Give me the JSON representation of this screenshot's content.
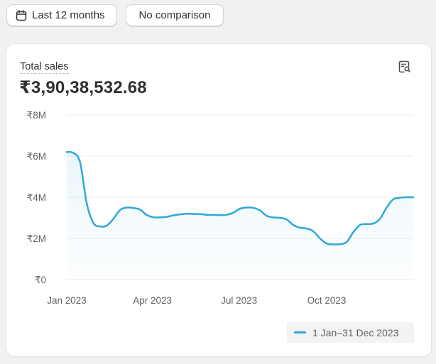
{
  "toolbar": {
    "date_range_label": "Last 12 months",
    "comparison_label": "No comparison",
    "date_range_icon": "calendar-icon"
  },
  "card": {
    "metric_title": "Total sales",
    "metric_value": "₹3,90,38,532.68",
    "explore_icon": "data-explore-icon"
  },
  "chart_data": {
    "type": "line",
    "title": "",
    "xlabel": "",
    "ylabel": "",
    "ylim": [
      0,
      8000000
    ],
    "y_ticks": [
      0,
      2000000,
      4000000,
      6000000,
      8000000
    ],
    "y_tick_labels": [
      "₹0",
      "₹2M",
      "₹4M",
      "₹6M",
      "₹8M"
    ],
    "x_tick_labels": [
      "Jan 2023",
      "Apr 2023",
      "Jul 2023",
      "Oct 2023"
    ],
    "x_tick_positions": [
      "2023-01-01",
      "2023-04-01",
      "2023-07-01",
      "2023-10-01"
    ],
    "grid": true,
    "legend_position": "bottom-right",
    "color": "#2fa8d8",
    "series": [
      {
        "name": "1 Jan–31 Dec 2023",
        "x": [
          "2023-01-01",
          "2023-01-08",
          "2023-01-15",
          "2023-01-22",
          "2023-01-29",
          "2023-02-05",
          "2023-02-12",
          "2023-02-19",
          "2023-02-26",
          "2023-03-05",
          "2023-03-12",
          "2023-03-19",
          "2023-03-26",
          "2023-04-02",
          "2023-04-09",
          "2023-04-16",
          "2023-04-23",
          "2023-04-30",
          "2023-05-07",
          "2023-05-14",
          "2023-05-21",
          "2023-05-28",
          "2023-06-04",
          "2023-06-11",
          "2023-06-18",
          "2023-06-25",
          "2023-07-02",
          "2023-07-09",
          "2023-07-16",
          "2023-07-23",
          "2023-07-30",
          "2023-08-06",
          "2023-08-13",
          "2023-08-20",
          "2023-08-27",
          "2023-09-03",
          "2023-09-10",
          "2023-09-17",
          "2023-09-24",
          "2023-10-01",
          "2023-10-08",
          "2023-10-15",
          "2023-10-22",
          "2023-10-29",
          "2023-11-05",
          "2023-11-12",
          "2023-11-19",
          "2023-11-26",
          "2023-12-03",
          "2023-12-10",
          "2023-12-17",
          "2023-12-24",
          "2023-12-31"
        ],
        "values": [
          6200000,
          6150000,
          5700000,
          3700000,
          2750000,
          2580000,
          2620000,
          2950000,
          3380000,
          3500000,
          3480000,
          3400000,
          3140000,
          3030000,
          3020000,
          3050000,
          3120000,
          3170000,
          3200000,
          3190000,
          3180000,
          3150000,
          3140000,
          3130000,
          3150000,
          3250000,
          3440000,
          3500000,
          3490000,
          3360000,
          3100000,
          3020000,
          3000000,
          2920000,
          2650000,
          2520000,
          2480000,
          2350000,
          2000000,
          1750000,
          1710000,
          1720000,
          1820000,
          2300000,
          2650000,
          2700000,
          2720000,
          2950000,
          3500000,
          3900000,
          3980000,
          4000000,
          4000000
        ]
      }
    ]
  }
}
